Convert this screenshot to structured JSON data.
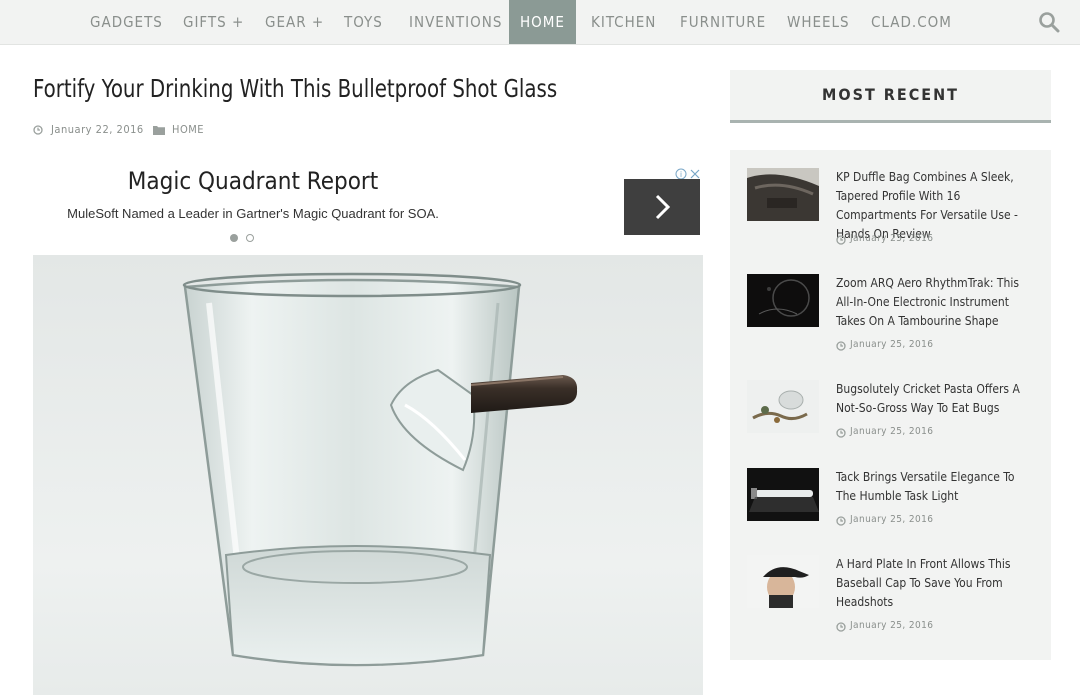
{
  "nav": {
    "items": [
      "GADGETS",
      "GIFTS +",
      "GEAR +",
      "TOYS",
      "INVENTIONS",
      "HOME",
      "KITCHEN",
      "FURNITURE",
      "WHEELS",
      "CLAD.COM"
    ],
    "active": "HOME",
    "search_icon": "search-icon"
  },
  "article": {
    "title": "Fortify Your Drinking With This Bulletproof Shot Glass",
    "date": "January 22, 2016",
    "category": "HOME"
  },
  "ad": {
    "title": "Magic Quadrant Report",
    "subtitle": "MuleSoft Named a Leader in Gartner's Magic Quadrant for SOA.",
    "next_icon": "chevron-right-icon",
    "slides": 2,
    "active_slide": 1
  },
  "sidebar": {
    "heading": "MOST RECENT",
    "posts": [
      {
        "title": "KP Duffle Bag Combines A Sleek, Tapered Profile With 16 Compartments For Versatile Use - Hands On Review",
        "date": "January 25, 2016"
      },
      {
        "title": "Zoom ARQ Aero RhythmTrak: This All-In-One Electronic Instrument Takes On A Tambourine Shape",
        "date": "January 25, 2016"
      },
      {
        "title": "Bugsolutely Cricket Pasta Offers A Not-So-Gross Way To Eat Bugs",
        "date": "January 25, 2016"
      },
      {
        "title": "Tack Brings Versatile Elegance To The Humble Task Light",
        "date": "January 25, 2016"
      },
      {
        "title": "A Hard Plate In Front Allows This Baseball Cap To Save You From Headshots",
        "date": "January 25, 2016"
      }
    ]
  },
  "colors": {
    "nav_bg": "#f2f3f2",
    "nav_active": "#8b9a95",
    "nav_text": "#8a8f8c",
    "sidebar_bg": "#f2f3f2",
    "accent_rule": "#a9b3b0"
  }
}
